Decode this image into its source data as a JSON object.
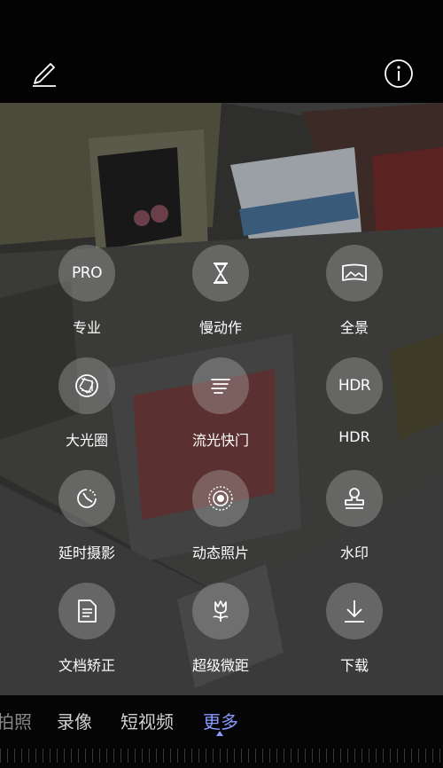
{
  "topbar": {
    "edit_icon": "pencil-icon",
    "info_icon": "info-icon"
  },
  "modes": [
    {
      "label": "专业",
      "glyph": "PRO",
      "icon": "pro-icon"
    },
    {
      "label": "慢动作",
      "icon": "hourglass-icon"
    },
    {
      "label": "全景",
      "icon": "panorama-icon"
    },
    {
      "label": "大光圈",
      "icon": "aperture-icon"
    },
    {
      "label": "流光快门",
      "icon": "light-trails-icon"
    },
    {
      "label": "HDR",
      "glyph": "HDR",
      "icon": "hdr-icon"
    },
    {
      "label": "延时摄影",
      "icon": "timelapse-icon"
    },
    {
      "label": "动态照片",
      "icon": "moving-picture-icon"
    },
    {
      "label": "水印",
      "icon": "stamp-icon"
    },
    {
      "label": "文档矫正",
      "icon": "document-icon"
    },
    {
      "label": "超级微距",
      "icon": "macro-flower-icon"
    },
    {
      "label": "下载",
      "icon": "download-icon"
    }
  ],
  "tabs": {
    "partial": "拍照",
    "items": [
      "录像",
      "短视频",
      "更多"
    ],
    "active": "更多"
  },
  "colors": {
    "accent": "#8a9bff",
    "circle": "rgba(205,205,205,0.30)"
  }
}
